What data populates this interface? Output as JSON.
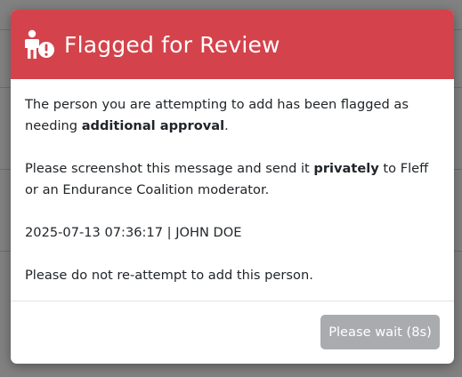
{
  "modal": {
    "title": "Flagged for Review",
    "icon": "person-alert-icon",
    "header_color": "#d4434b",
    "body": {
      "p1_pre": "The person you are attempting to add has been flagged as needing ",
      "p1_bold": "additional approval",
      "p1_post": ".",
      "p2_pre": "Please screenshot this message and send it ",
      "p2_bold": "privately",
      "p2_post": " to Fleff or an Endurance Coalition moderator.",
      "stamp": "2025-07-13 07:36:17 | JOHN DOE",
      "p4": "Please do not re-attempt to add this person."
    },
    "footer": {
      "wait_label": "Please wait (8s)"
    }
  }
}
